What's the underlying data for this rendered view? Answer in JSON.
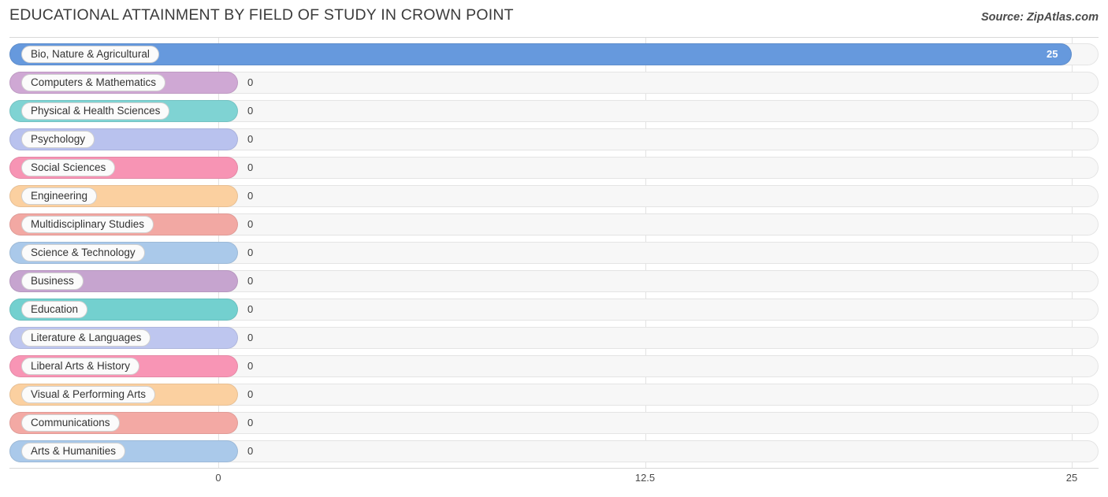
{
  "header": {
    "title": "EDUCATIONAL ATTAINMENT BY FIELD OF STUDY IN CROWN POINT",
    "source": "Source: ZipAtlas.com"
  },
  "chart_data": {
    "type": "bar",
    "orientation": "horizontal",
    "title": "EDUCATIONAL ATTAINMENT BY FIELD OF STUDY IN CROWN POINT",
    "xlabel": "",
    "ylabel": "",
    "xlim": [
      0,
      25
    ],
    "xticks": [
      "0",
      "12.5",
      "25"
    ],
    "xtick_values": [
      0,
      12.5,
      25
    ],
    "grid": true,
    "legend": "none",
    "categories": [
      "Bio, Nature & Agricultural",
      "Computers & Mathematics",
      "Physical & Health Sciences",
      "Psychology",
      "Social Sciences",
      "Engineering",
      "Multidisciplinary Studies",
      "Science & Technology",
      "Business",
      "Education",
      "Literature & Languages",
      "Liberal Arts & History",
      "Visual & Performing Arts",
      "Communications",
      "Arts & Humanities"
    ],
    "values": [
      25,
      0,
      0,
      0,
      0,
      0,
      0,
      0,
      0,
      0,
      0,
      0,
      0,
      0,
      0
    ],
    "value_labels": [
      "25",
      "0",
      "0",
      "0",
      "0",
      "0",
      "0",
      "0",
      "0",
      "0",
      "0",
      "0",
      "0",
      "0",
      "0"
    ],
    "colors": [
      "#6699dd",
      "#cfa8d4",
      "#7fd3d3",
      "#b9c2ee",
      "#f794b4",
      "#fbd0a0",
      "#f2a8a3",
      "#aac9ea",
      "#c6a4cf",
      "#73d0cf",
      "#bec6ef",
      "#f895b5",
      "#fbd0a0",
      "#f3a9a4",
      "#aac9ea"
    ]
  }
}
